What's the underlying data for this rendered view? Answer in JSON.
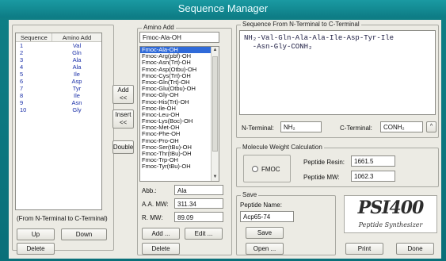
{
  "window": {
    "title": "Sequence Manager"
  },
  "sequence_list": {
    "headers": [
      "Sequence",
      "Amino Add"
    ],
    "rows": [
      [
        "1",
        "Val"
      ],
      [
        "2",
        "Gln"
      ],
      [
        "3",
        "Ala"
      ],
      [
        "4",
        "Ala"
      ],
      [
        "5",
        "Ile"
      ],
      [
        "6",
        "Asp"
      ],
      [
        "7",
        "Tyr"
      ],
      [
        "8",
        "Ile"
      ],
      [
        "9",
        "Asn"
      ],
      [
        "10",
        "Gly"
      ]
    ],
    "direction_note": "(From N-Terminal to C-Terminal)"
  },
  "buttons": {
    "up": "Up",
    "down": "Down",
    "delete_left": "Delete",
    "add_arrow": "Add\n<<",
    "insert_arrow": "Insert\n<<",
    "double": "Double",
    "add_amino": "Add ...",
    "edit_amino": "Edit ...",
    "delete_amino": "Delete",
    "save": "Save",
    "open": "Open ...",
    "print": "Print",
    "done": "Done"
  },
  "amino_add": {
    "group_label": "Amino Add",
    "selected_value": "Fmoc-Ala-OH",
    "items": [
      "Fmoc-Ala-OH",
      "Fmoc-Arg(pbf)-OH",
      "Fmoc-Asn(Trt)-OH",
      "Fmoc-Asp(Otbu)-OH",
      "Fmoc-Cys(Trt)-OH",
      "Fmoc-Gln(Trt)-OH",
      "Fmoc-Glu(Otbu)-OH",
      "Fmoc-Gly-OH",
      "Fmoc-His(Trt)-OH",
      "Fmoc-Ile-OH",
      "Fmoc-Leu-OH",
      "Fmoc-Lys(Boc)-OH",
      "Fmoc-Met-OH",
      "Fmoc-Phe-OH",
      "Fmoc-Pro-OH",
      "Fmoc-Ser(tBu)-OH",
      "Fmoc-Thr(tBu)-OH",
      "Fmoc-Trp-OH",
      "Fmoc-Tyr(tBu)-OH"
    ],
    "selected_index": 0,
    "abb_label": "Abb.:",
    "abb_value": "Ala",
    "aamw_label": "A.A. MW:",
    "aamw_value": "311.34",
    "rmw_label": "R. MW:",
    "rmw_value": "89.09"
  },
  "sequence_view": {
    "group_label": "Sequence From N-Terminal to C-Terminal",
    "line1": "NH₂-Val-Gln-Ala-Ala-Ile-Asp-Tyr-Ile",
    "line2": "  -Asn-Gly-CONH₂",
    "n_terminal_label": "N-Terminal:",
    "n_terminal_value": "NH₂",
    "c_terminal_label": "C-Terminal:",
    "c_terminal_value": "CONH₂"
  },
  "mw_calc": {
    "group_label": "Molecule Weight Calculation",
    "fmoc_label": "FMOC",
    "resin_label": "Peptide Resin:",
    "resin_value": "1661.5",
    "mw_label": "Peptide MW:",
    "mw_value": "1062.3"
  },
  "save_group": {
    "group_label": "Save",
    "peptide_name_label": "Peptide Name:",
    "peptide_name_value": "Acp65-74"
  },
  "logo": {
    "main": "PSI400",
    "sub": "Peptide Synthesizer"
  }
}
